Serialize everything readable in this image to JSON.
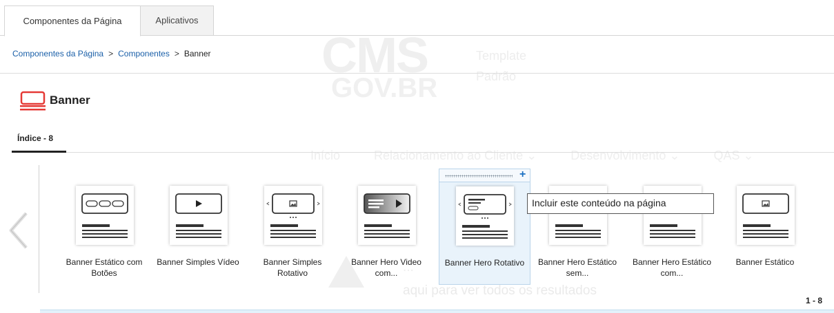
{
  "background": {
    "logo_top": "CMS",
    "logo_bottom": "GOV.BR",
    "template_label": "Template",
    "template_value": "Padrão",
    "menu": [
      "Início",
      "Relacionamento ao Cliente ⌄",
      "Desenvolvimento ⌄",
      "QAS ⌄"
    ],
    "message_line1": "...",
    "message_line2": "aqui para ver todos os resultados"
  },
  "tabs": [
    {
      "label": "Componentes da Página",
      "active": true
    },
    {
      "label": "Aplicativos",
      "active": false
    }
  ],
  "breadcrumb": {
    "items": [
      "Componentes da Página",
      "Componentes"
    ],
    "separator": ">",
    "current": "Banner"
  },
  "section": {
    "title": "Banner",
    "icon": "banner-icon",
    "accent_color": "#e53935"
  },
  "index_tab": {
    "label": "Índice - 8"
  },
  "cards": [
    {
      "label": "Banner Estático com Botões",
      "icon": "banner-buttons-thumb"
    },
    {
      "label": "Banner Simples Vídeo",
      "icon": "banner-video-thumb"
    },
    {
      "label": "Banner Simples Rotativo",
      "icon": "banner-rotating-thumb"
    },
    {
      "label": "Banner Hero Video com...",
      "icon": "banner-hero-video-thumb"
    },
    {
      "label": "Banner Hero Rotativo",
      "icon": "banner-hero-rotating-thumb",
      "selected": true
    },
    {
      "label": "Banner Hero Estático sem...",
      "icon": "banner-hero-static-no-thumb"
    },
    {
      "label": "Banner Hero Estático com...",
      "icon": "banner-hero-static-with-thumb"
    },
    {
      "label": "Banner Estático",
      "icon": "banner-static-thumb"
    }
  ],
  "tooltip": "Incluir este conteúdo na página",
  "pager": "1 - 8",
  "colors": {
    "link": "#1a5fa8",
    "selected_bg": "#e9f3fb",
    "add_icon": "#1a6fc2"
  }
}
